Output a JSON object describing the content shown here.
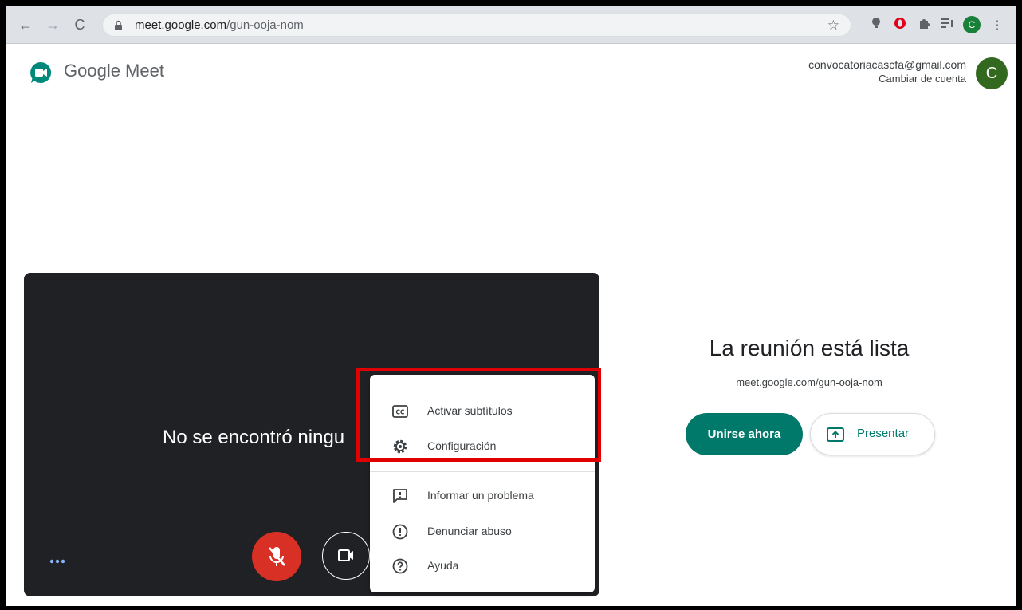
{
  "browser": {
    "url_host": "meet.google.com",
    "url_path": "/gun-ooja-nom",
    "profile_initial": "C"
  },
  "header": {
    "app_name": "Google Meet",
    "account_email": "convocatoriacascfa@gmail.com",
    "switch_account": "Cambiar de cuenta",
    "avatar_initial": "C"
  },
  "preview": {
    "no_camera_text": "No se encontró ningu"
  },
  "menu": {
    "items": [
      {
        "label": "Activar subtítulos",
        "icon": "closed-captions-icon"
      },
      {
        "label": "Configuración",
        "icon": "settings-gear-icon"
      },
      {
        "label": "Informar un problema",
        "icon": "feedback-icon"
      },
      {
        "label": "Denunciar abuso",
        "icon": "report-abuse-icon"
      },
      {
        "label": "Ayuda",
        "icon": "help-icon"
      }
    ]
  },
  "join_panel": {
    "title": "La reunión está lista",
    "meeting_link": "meet.google.com/gun-ooja-nom",
    "join_label": "Unirse ahora",
    "present_label": "Presentar"
  },
  "colors": {
    "accent_teal": "#00796b",
    "mic_off_red": "#d93025",
    "highlight_red": "#e00000",
    "avatar_green": "#33691e"
  }
}
